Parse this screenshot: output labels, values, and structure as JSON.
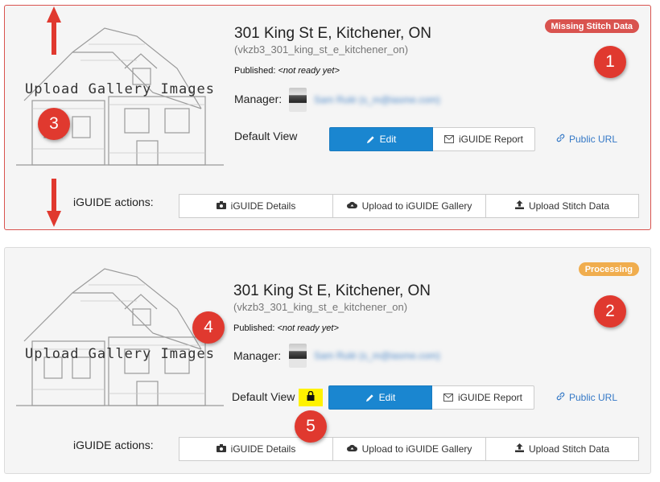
{
  "listings": [
    {
      "thumbnail_caption": "Upload Gallery Images",
      "address": "301 King St E, Kitchener, ON",
      "slug": "(vkzb3_301_king_st_e_kitchener_on)",
      "published_label": "Published:",
      "published_value": "<not ready yet>",
      "manager_label": "Manager:",
      "manager_name": "Sam Rulé (s_m@iasme.com)",
      "default_view_label": "Default View",
      "edit_label": "Edit",
      "report_label": "iGUIDE Report",
      "public_url_label": "Public URL",
      "actions_label": "iGUIDE actions:",
      "action_details": "iGUIDE Details",
      "action_gallery": "Upload to iGUIDE Gallery",
      "action_stitch": "Upload Stitch Data",
      "status_badge": "Missing Stitch Data",
      "status_color": "#d9534f"
    },
    {
      "thumbnail_caption": "Upload Gallery Images",
      "address": "301 King St E, Kitchener, ON",
      "slug": "(vkzb3_301_king_st_e_kitchener_on)",
      "published_label": "Published:",
      "published_value": "<not ready yet>",
      "manager_label": "Manager:",
      "manager_name": "Sam Rulé (s_m@iasme.com)",
      "default_view_label": "Default View",
      "edit_label": "Edit",
      "report_label": "iGUIDE Report",
      "public_url_label": "Public URL",
      "actions_label": "iGUIDE actions:",
      "action_details": "iGUIDE Details",
      "action_gallery": "Upload to iGUIDE Gallery",
      "action_stitch": "Upload Stitch Data",
      "status_badge": "Processing",
      "status_color": "#f0ad4e",
      "lock_icon": "lock-icon"
    }
  ],
  "annotations": {
    "m1": "1",
    "m2": "2",
    "m3": "3",
    "m4": "4",
    "m5": "5",
    "color": "#e0392f",
    "highlight_color": "#fff200"
  }
}
